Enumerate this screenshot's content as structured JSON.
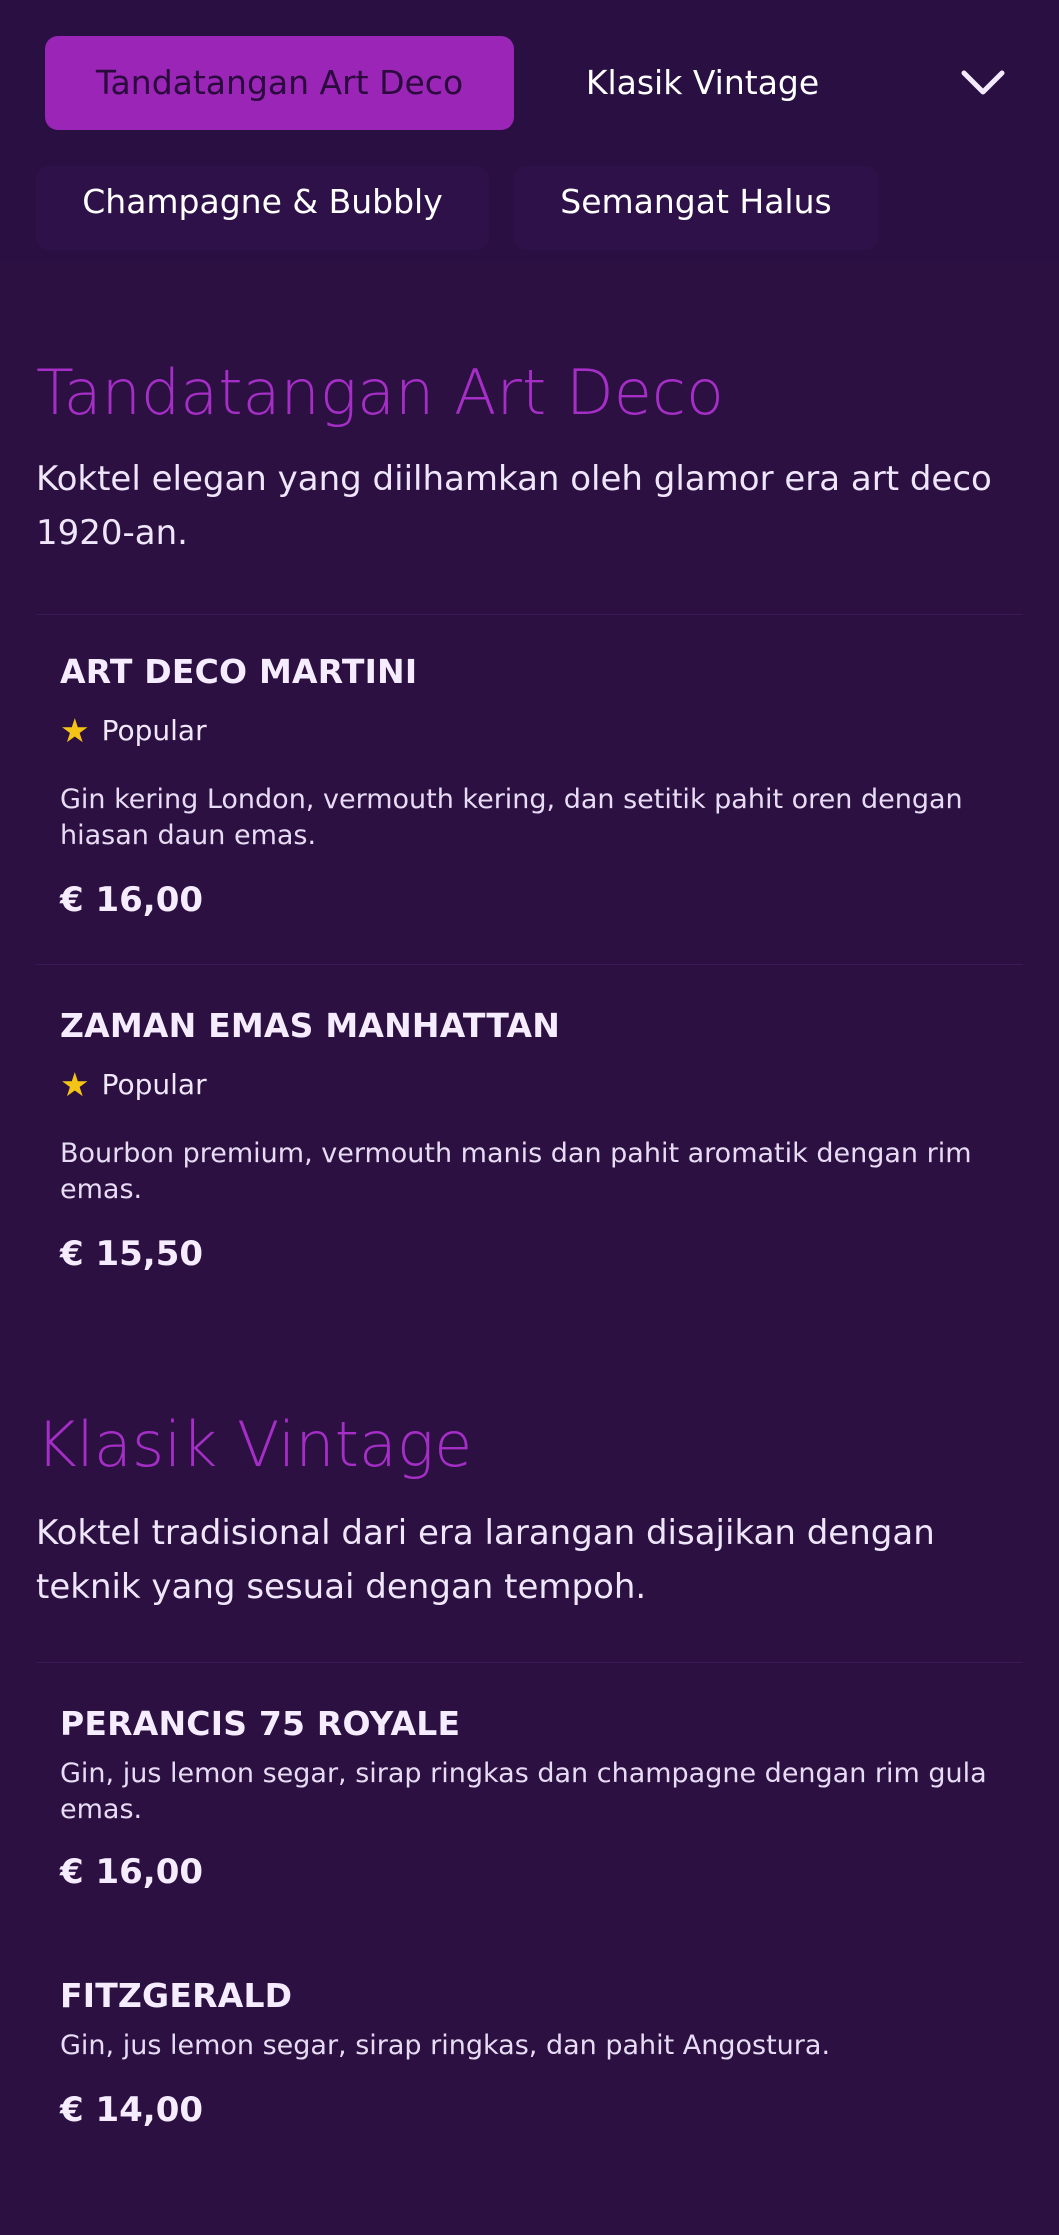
{
  "nav": {
    "tabs": [
      {
        "label": "Tandatangan Art Deco",
        "active": true
      },
      {
        "label": "Klasik Vintage",
        "active": false
      },
      {
        "label": "Champagne & Bubbly",
        "active": false
      },
      {
        "label": "Semangat Halus",
        "active": false
      }
    ],
    "more_icon": "chevron-down-icon"
  },
  "sections": [
    {
      "title": "Tandatangan Art Deco",
      "description": "Koktel elegan yang diilhamkan oleh glamor era art deco 1920-an.",
      "items": [
        {
          "name": "ART DECO MARTINI",
          "badge": "Popular",
          "badge_icon": "star-icon",
          "description": "Gin kering London, vermouth kering, dan setitik pahit oren dengan hiasan daun emas.",
          "price": "€ 16,00"
        },
        {
          "name": "ZAMAN EMAS MANHATTAN",
          "badge": "Popular",
          "badge_icon": "star-icon",
          "description": "Bourbon premium, vermouth manis dan pahit aromatik dengan rim emas.",
          "price": "€ 15,50"
        }
      ]
    },
    {
      "title": "Klasik Vintage",
      "description": "Koktel tradisional dari era larangan disajikan dengan teknik yang sesuai dengan tempoh.",
      "items": [
        {
          "name": "PERANCIS 75 ROYALE",
          "description": "Gin, jus lemon segar, sirap ringkas dan champagne dengan rim gula emas.",
          "price": "€ 16,00"
        },
        {
          "name": "FITZGERALD",
          "description": "Gin, jus lemon segar, sirap ringkas, dan pahit Angostura.",
          "price": "€ 14,00"
        }
      ]
    }
  ],
  "colors": {
    "background": "#2c1042",
    "accent": "#9b25b7",
    "title": "#a52ec6",
    "star": "#f3c315"
  }
}
